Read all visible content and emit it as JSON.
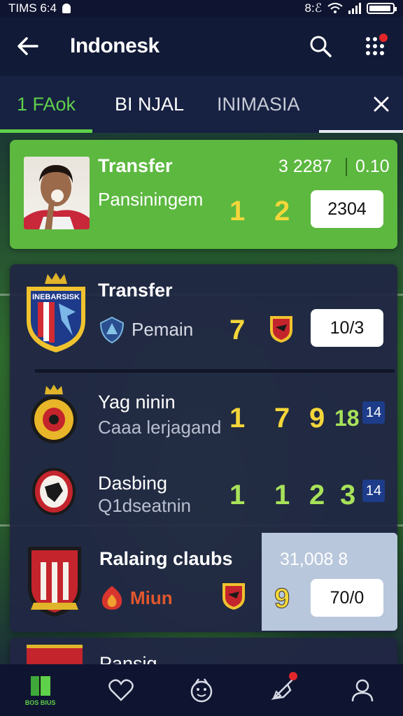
{
  "status_bar": {
    "time": "TIMS 6:4",
    "right_text": "8:ℰ"
  },
  "app_bar": {
    "title": "Indonesk"
  },
  "tabs": [
    {
      "label": "1 FAok",
      "active": true
    },
    {
      "label": "BI NJAL",
      "active": false
    },
    {
      "label": "INIMASIA",
      "active": false
    }
  ],
  "cards": {
    "featured": {
      "title": "Transfer",
      "subtitle": "Pansiningem",
      "score_a": "1",
      "score_b": "2",
      "stat_1": "3 2287",
      "stat_2": "0.10",
      "value": "2304"
    },
    "transfer": {
      "crest_text": "INEBARSISK",
      "title": "Transfer",
      "subtitle": "Pemain",
      "number": "7",
      "value": "10/3"
    },
    "row_1": {
      "title": "Yag ninin",
      "subtitle": "Caaa lerjagand",
      "numbers": [
        "1",
        "7",
        "9",
        "18"
      ],
      "badge": "14"
    },
    "row_2": {
      "title": "Dasbing",
      "subtitle": "Q1dseatnin",
      "numbers": [
        "1",
        "1",
        "2",
        "3"
      ],
      "badge": "14"
    },
    "ranking": {
      "title": "Ralaing claubs",
      "subtitle": "Miun",
      "stat": "31,008 8",
      "number": "9",
      "value": "70/0"
    },
    "partial": {
      "title": "Pansig"
    }
  },
  "bottom_nav": {
    "items": [
      {
        "icon": "home-icon",
        "label": "BOS BIUS",
        "active": true
      },
      {
        "icon": "heart-icon",
        "label": ""
      },
      {
        "icon": "face-icon",
        "label": ""
      },
      {
        "icon": "rocket-icon",
        "label": ""
      },
      {
        "icon": "profile-icon",
        "label": ""
      }
    ]
  },
  "colors": {
    "accent_green": "#5cb83f",
    "tab_active": "#5fd04a",
    "number_yellow": "#f4d63a",
    "background": "#141b33"
  }
}
